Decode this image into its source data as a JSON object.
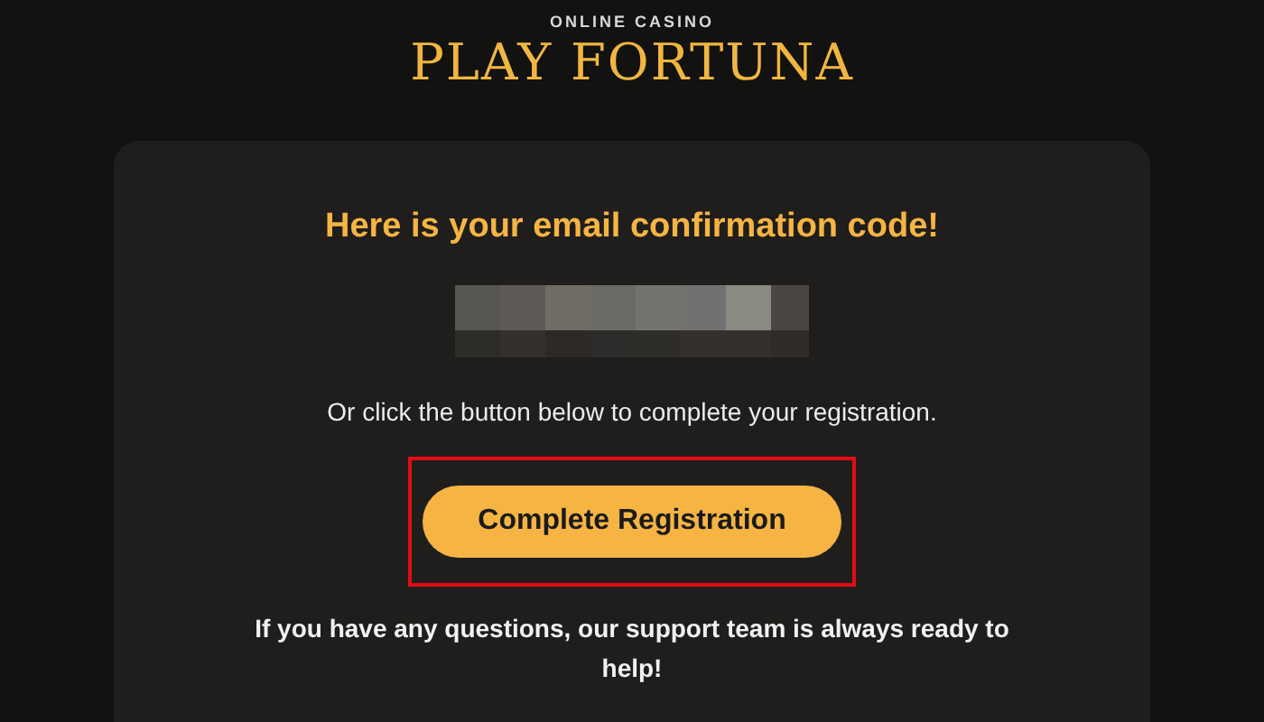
{
  "logo": {
    "tagline": "ONLINE CASINO",
    "name": "PLAY FORTUNA"
  },
  "email": {
    "heading": "Here is your email confirmation code!",
    "instruction": "Or click the button below to complete your registration.",
    "button": {
      "label": "Complete Registration",
      "highlighted": true
    },
    "footer": "If you have any questions, our support team is always ready to help!"
  }
}
